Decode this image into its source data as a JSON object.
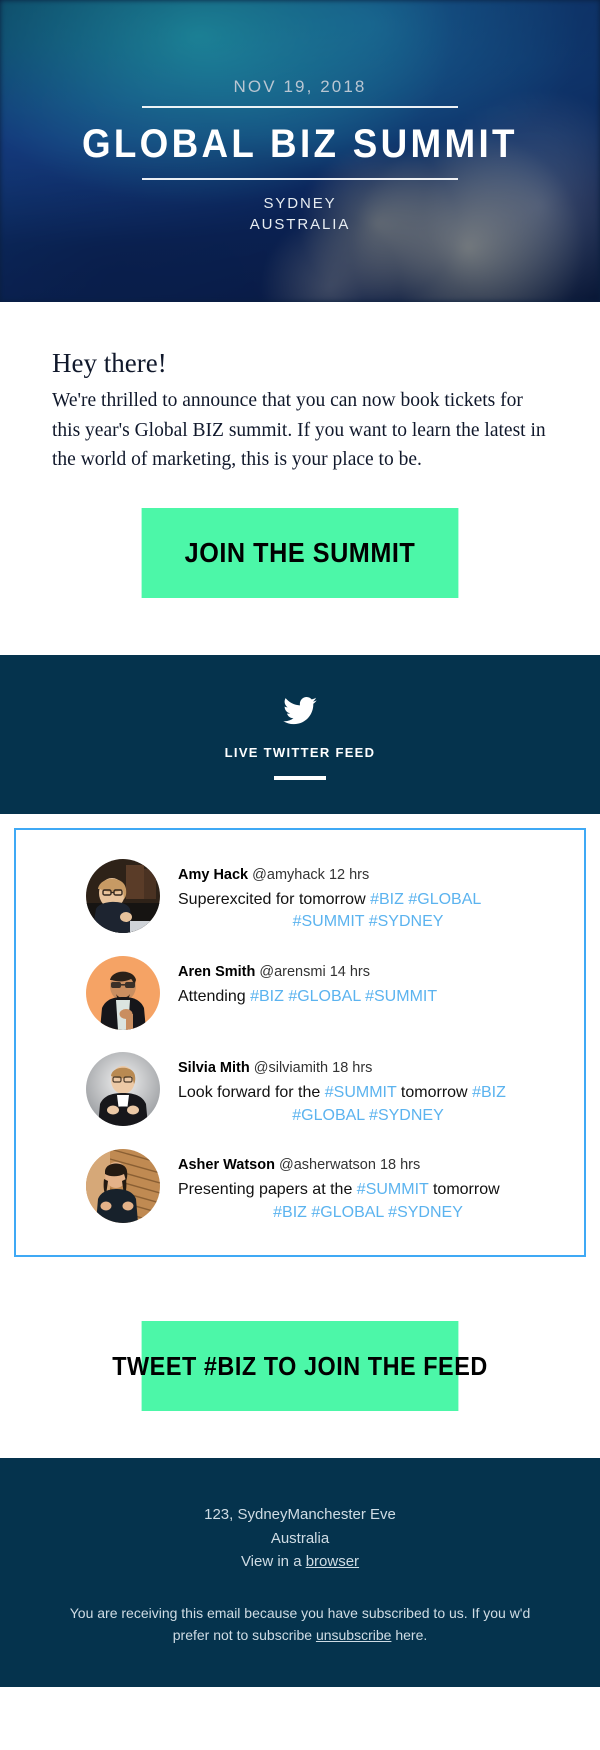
{
  "hero": {
    "date": "NOV 19, 2018",
    "title": "GLOBAL BIZ SUMMIT",
    "city": "SYDNEY",
    "country": "AUSTRALIA"
  },
  "intro": {
    "heading": "Hey there!",
    "body": "We're thrilled to announce that you can now book tickets for this year's Global BIZ summit. If you want to learn the latest in the world of marketing, this is your place to be."
  },
  "cta_primary": {
    "label": "JOIN THE SUMMIT"
  },
  "cta_secondary": {
    "label": "TWEET #BIZ TO JOIN THE FEED"
  },
  "twitter_section": {
    "title": "LIVE TWITTER FEED",
    "icon": "twitter-bird-icon"
  },
  "tweets": [
    {
      "name": "Amy Hack",
      "handle": "@amyhack",
      "time": "12 hrs",
      "text_line1": "Superexcited for tomorrow",
      "tags_line1": [
        "#BIZ",
        "#GLOBAL"
      ],
      "tags_line2": [
        "#SUMMIT",
        "#SYDNEY"
      ],
      "avatar": "avatar-amy-hack"
    },
    {
      "name": "Aren Smith",
      "handle": "@arensmi",
      "time": "14 hrs",
      "text_line1": "Attending",
      "tags_line1": [
        "#BIZ",
        "#GLOBAL",
        "#SUMMIT"
      ],
      "tags_line2": [],
      "avatar": "avatar-aren-smith"
    },
    {
      "name": "Silvia Mith",
      "handle": "@silviamith",
      "time": "18 hrs",
      "text_line1": "Look forward for the",
      "mid_tag": "#SUMMIT",
      "text_mid": "tomorrow",
      "tags_line1": [
        "#BIZ"
      ],
      "tags_line2": [
        "#GLOBAL",
        "#SYDNEY"
      ],
      "avatar": "avatar-silvia-mith"
    },
    {
      "name": "Asher Watson",
      "handle": "@asherwatson",
      "time": "18 hrs",
      "text_line1": "Presenting papers at the",
      "mid_tag": "#SUMMIT",
      "text_mid": "tomorrow",
      "tags_line1": [],
      "tags_line2": [
        "#BIZ",
        "#GLOBAL",
        "#SYDNEY"
      ],
      "avatar": "avatar-asher-watson"
    }
  ],
  "footer": {
    "address_line1": "123, SydneyManchester Eve",
    "address_line2": "Australia",
    "view_prefix": "View in a",
    "view_link": "browser",
    "disclaimer_part1": "You are receiving this email because you have subscribed to us. If you w'd prefer not to subscribe",
    "disclaimer_link": "unsubscribe",
    "disclaimer_part2": "here."
  },
  "colors": {
    "accent_green": "#4cf7a8",
    "navy": "#05334d",
    "tag_blue": "#5bb3ef",
    "feed_border": "#3fa9f5"
  }
}
